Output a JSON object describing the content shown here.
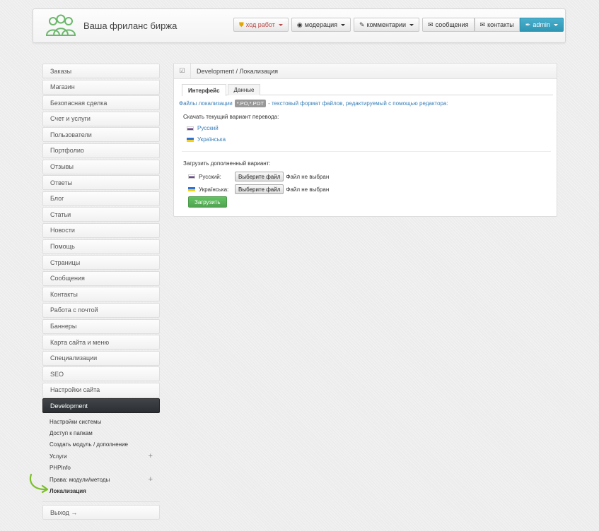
{
  "header": {
    "site_title": "Ваша фриланс биржа",
    "nav": [
      {
        "label": "ход работ",
        "icon": "shield-icon",
        "color": "#b94a48"
      },
      {
        "label": "модерация",
        "icon": "eye-icon"
      },
      {
        "label": "комментарии",
        "icon": "pencil-icon"
      },
      {
        "label": "сообщения",
        "icon": "envelope-icon"
      },
      {
        "label": "контакты",
        "icon": "envelope-icon"
      },
      {
        "label": "admin",
        "icon": "wrench-icon",
        "color": "#2f96b4"
      }
    ]
  },
  "sidebar": {
    "items": [
      "Заказы",
      "Магазин",
      "Безопасная сделка",
      "Счет и услуги",
      "Пользователи",
      "Портфолио",
      "Отзывы",
      "Ответы",
      "Блог",
      "Статьи",
      "Новости",
      "Помощь",
      "Страницы",
      "Сообщения",
      "Контакты",
      "Работа с почтой",
      "Баннеры",
      "Карта сайта и меню",
      "Специализации",
      "SEO",
      "Настройки сайта",
      "Development"
    ],
    "active_item": "Development",
    "subitems": [
      {
        "label": "Настройки системы",
        "plus": false
      },
      {
        "label": "Доступ к папкам",
        "plus": false
      },
      {
        "label": "Создать модуль / дополнение",
        "plus": false
      },
      {
        "label": "Услуги",
        "plus": true
      },
      {
        "label": "PHPInfo",
        "plus": false
      },
      {
        "label": "Права: модули/методы",
        "plus": true
      },
      {
        "label": "Локализация",
        "plus": false,
        "current": true
      }
    ],
    "logout_label": "Выход →"
  },
  "panel": {
    "breadcrumb": "Development / Локализация",
    "tabs": [
      {
        "label": "Интерфейс",
        "active": true
      },
      {
        "label": "Данные",
        "active": false
      }
    ],
    "info_prefix": "Файлы локализации",
    "info_badge": "*.PO,*.POT",
    "info_suffix": "- текстовый формат файлов, редактируемый с помощью редактора:",
    "download_label": "Скачать текущий вариант перевода:",
    "download_links": [
      {
        "label": "Русский",
        "flag": "ru"
      },
      {
        "label": "Українська",
        "flag": "ua"
      }
    ],
    "upload_label": "Загрузить дополненный вариант:",
    "upload_rows": [
      {
        "label": "Русский:",
        "flag": "ru",
        "button": "Выберите файл",
        "status": "Файл не выбран"
      },
      {
        "label": "Українська:",
        "flag": "ua",
        "button": "Выберите файл",
        "status": "Файл не выбран"
      }
    ],
    "submit_label": "Загрузить"
  },
  "colors": {
    "accent_blue": "#2f96b4",
    "link_blue": "#3a7fb8",
    "submit_green": "#51a351",
    "active_dark": "#2b2f33",
    "logo_green": "#6bb86b",
    "arrow_green": "#7cbf2a"
  }
}
